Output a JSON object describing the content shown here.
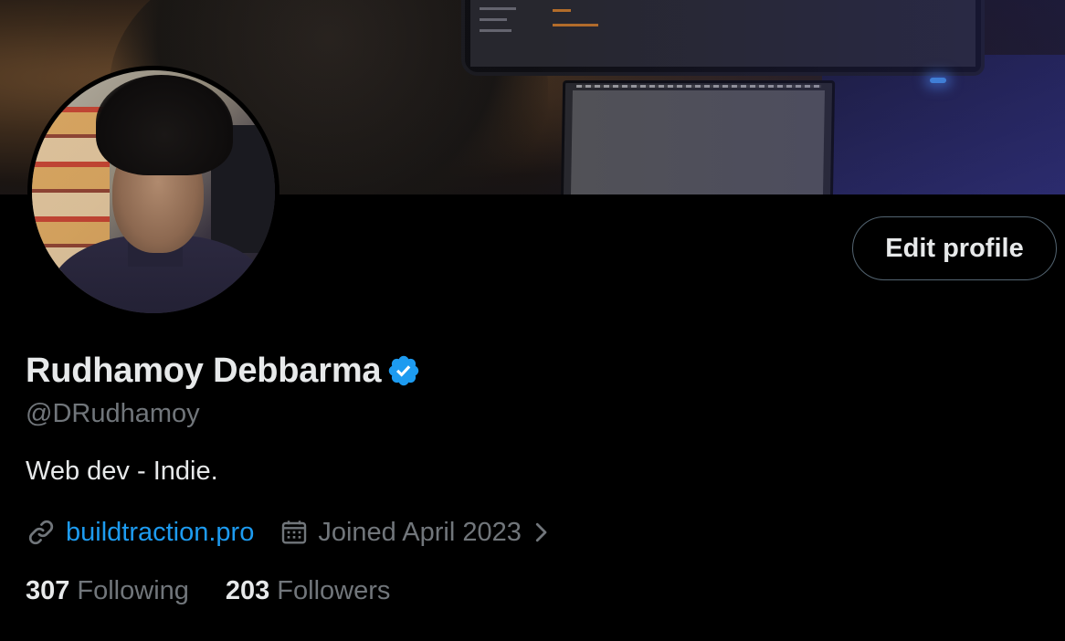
{
  "profile": {
    "display_name": "Rudhamoy Debbarma",
    "handle": "@DRudhamoy",
    "bio": "Web dev - Indie.",
    "website": "buildtraction.pro",
    "joined": "Joined April 2023",
    "verified": true
  },
  "actions": {
    "edit_profile_label": "Edit profile"
  },
  "stats": {
    "following_count": "307",
    "following_label": "Following",
    "followers_count": "203",
    "followers_label": "Followers"
  },
  "icons": {
    "verified": "verified-badge-icon",
    "website": "link-icon",
    "joined": "calendar-icon",
    "expand": "chevron-right-icon"
  },
  "colors": {
    "background": "#000000",
    "text_primary": "#e7e9ea",
    "text_secondary": "#71767b",
    "accent": "#1d9bf0",
    "button_border": "#536471"
  }
}
